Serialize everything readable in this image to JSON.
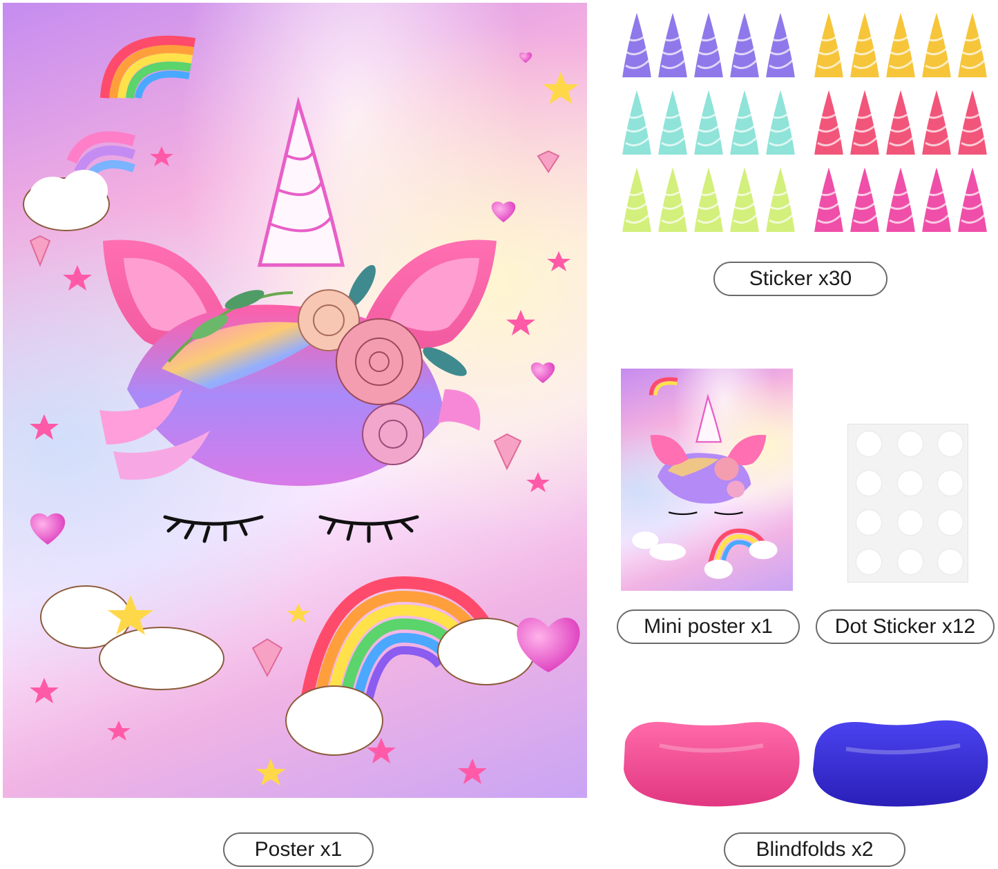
{
  "labels": {
    "stickers": "Sticker x30",
    "mini_poster": "Mini poster x1",
    "dot_stickers": "Dot Sticker x12",
    "poster": "Poster x1",
    "blindfolds": "Blindfolds x2"
  },
  "colors": {
    "blindfold_pink": "#f2468f",
    "blindfold_blue": "#3b2ed8",
    "horn_purple": "#8f78ea",
    "horn_yellow": "#f6c53a",
    "horn_teal": "#8fe3d8",
    "horn_red": "#f2557a",
    "horn_lime": "#d3ef7c",
    "horn_magenta": "#ef4fa8"
  },
  "icons": [
    "unicorn-horn-icon",
    "rainbow-icon",
    "cloud-icon",
    "heart-icon",
    "star-icon",
    "diamond-icon",
    "eyelash-icon",
    "flower-icon"
  ]
}
